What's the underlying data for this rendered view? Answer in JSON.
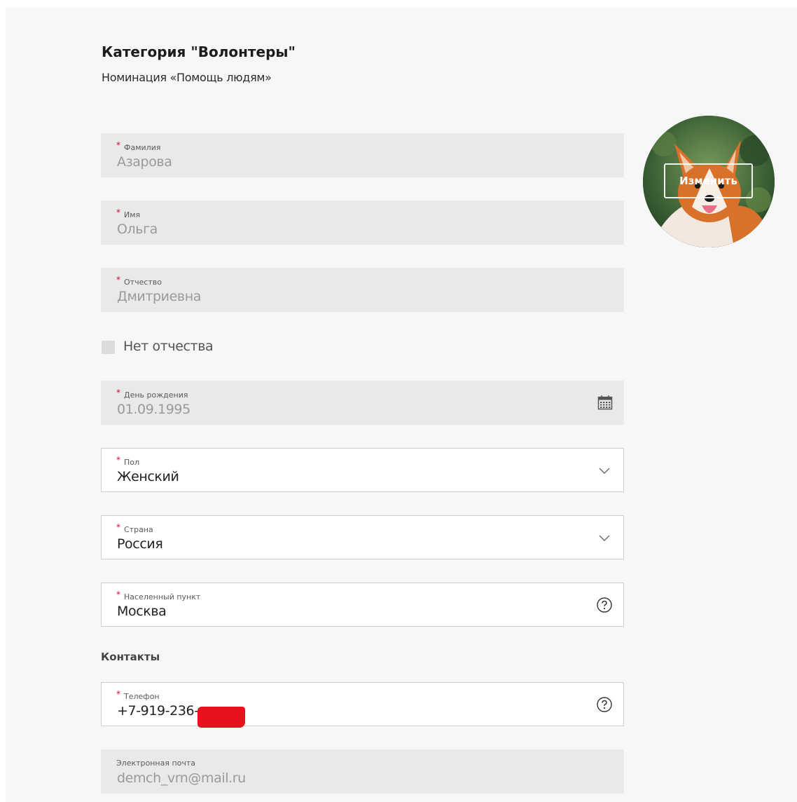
{
  "header": {
    "title": "Категория \"Волонтеры\"",
    "subtitle": "Номинация «Помощь людям»"
  },
  "form": {
    "required_mark": "*",
    "last_name": {
      "label": "Фамилия",
      "value": "Азарова",
      "required": true,
      "disabled": true
    },
    "first_name": {
      "label": "Имя",
      "value": "Ольга",
      "required": true,
      "disabled": true
    },
    "patronymic": {
      "label": "Отчество",
      "value": "Дмитриевна",
      "required": true,
      "disabled": true
    },
    "no_patronymic": {
      "label": "Нет отчества",
      "checked": false
    },
    "birthday": {
      "label": "День рождения",
      "value": "01.09.1995",
      "required": true,
      "disabled": true,
      "icon": "calendar-icon"
    },
    "gender": {
      "label": "Пол",
      "value": "Женский",
      "required": true,
      "icon": "chevron-down-icon"
    },
    "country": {
      "label": "Страна",
      "value": "Россия",
      "required": true,
      "icon": "chevron-down-icon"
    },
    "city": {
      "label": "Населенный пункт",
      "value": "Москва",
      "required": true,
      "icon": "help-icon"
    },
    "contacts_heading": "Контакты",
    "phone": {
      "label": "Телефон",
      "value": "+7-919-236-",
      "required": true,
      "icon": "help-icon"
    },
    "email": {
      "label": "Электронная почта",
      "value": "demch_vrn@mail.ru",
      "required": false,
      "disabled": true
    }
  },
  "avatar": {
    "change_label": "Изменить"
  },
  "colors": {
    "required": "#c8102e",
    "redaction": "#e8121f",
    "disabled_field": "#e9e9ea"
  }
}
